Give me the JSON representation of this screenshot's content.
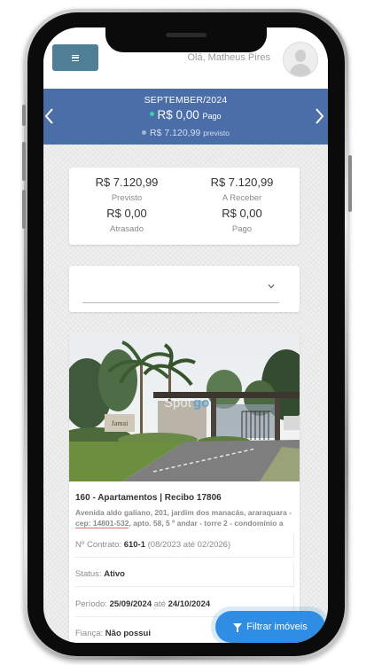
{
  "header": {
    "greeting": "Olá, Matheus Pires"
  },
  "month": {
    "title": "SEPTEMBER/2024",
    "paid_value": "R$ 0,00",
    "paid_label": "Pago",
    "expected_value": "R$ 7.120,99",
    "expected_label": "previsto",
    "prev_icon": "chevron-left-icon",
    "next_icon": "chevron-right-icon"
  },
  "summary": {
    "left": {
      "value1": "R$ 7.120,99",
      "label1": "Previsto",
      "value2": "R$ 0,00",
      "label2": "Atrasado"
    },
    "right": {
      "value1": "R$ 7.120,99",
      "label1": "A Receber",
      "value2": "R$ 0,00",
      "label2": "Pago"
    }
  },
  "property_select": {
    "value": "",
    "caret_icon": "chevron-down-icon"
  },
  "property": {
    "title": "160 - Apartamentos | Recibo 17806",
    "address": "Avenida aldo galiano, 201, jardim dos manacás, araraquara - cep: 14801-532, apto. 58, 5 º andar - torre 2 - condomínio a",
    "image_sign": "go",
    "image_sign_prefix": "Spot",
    "image_sign_left": "Jamai",
    "contract_label": "Nº Contrato:",
    "contract_value": "610-1",
    "contract_range": "(08/2023 até 02/2026)",
    "status_label": "Status:",
    "status_value": "Ativo",
    "period_label": "Período:",
    "period_start": "25/09/2024",
    "period_connector": "até",
    "period_end": "24/10/2024",
    "guarantee_label": "Fiança:",
    "guarantee_value": "Não possui"
  },
  "filter_button": {
    "label": "Filtrar imóveis",
    "icon": "filter-icon"
  },
  "colors": {
    "banner": "#4b6ea9",
    "menu_button": "#4f7f95",
    "paid_dot": "#39d3a6",
    "filter_button": "#2f8de4"
  }
}
